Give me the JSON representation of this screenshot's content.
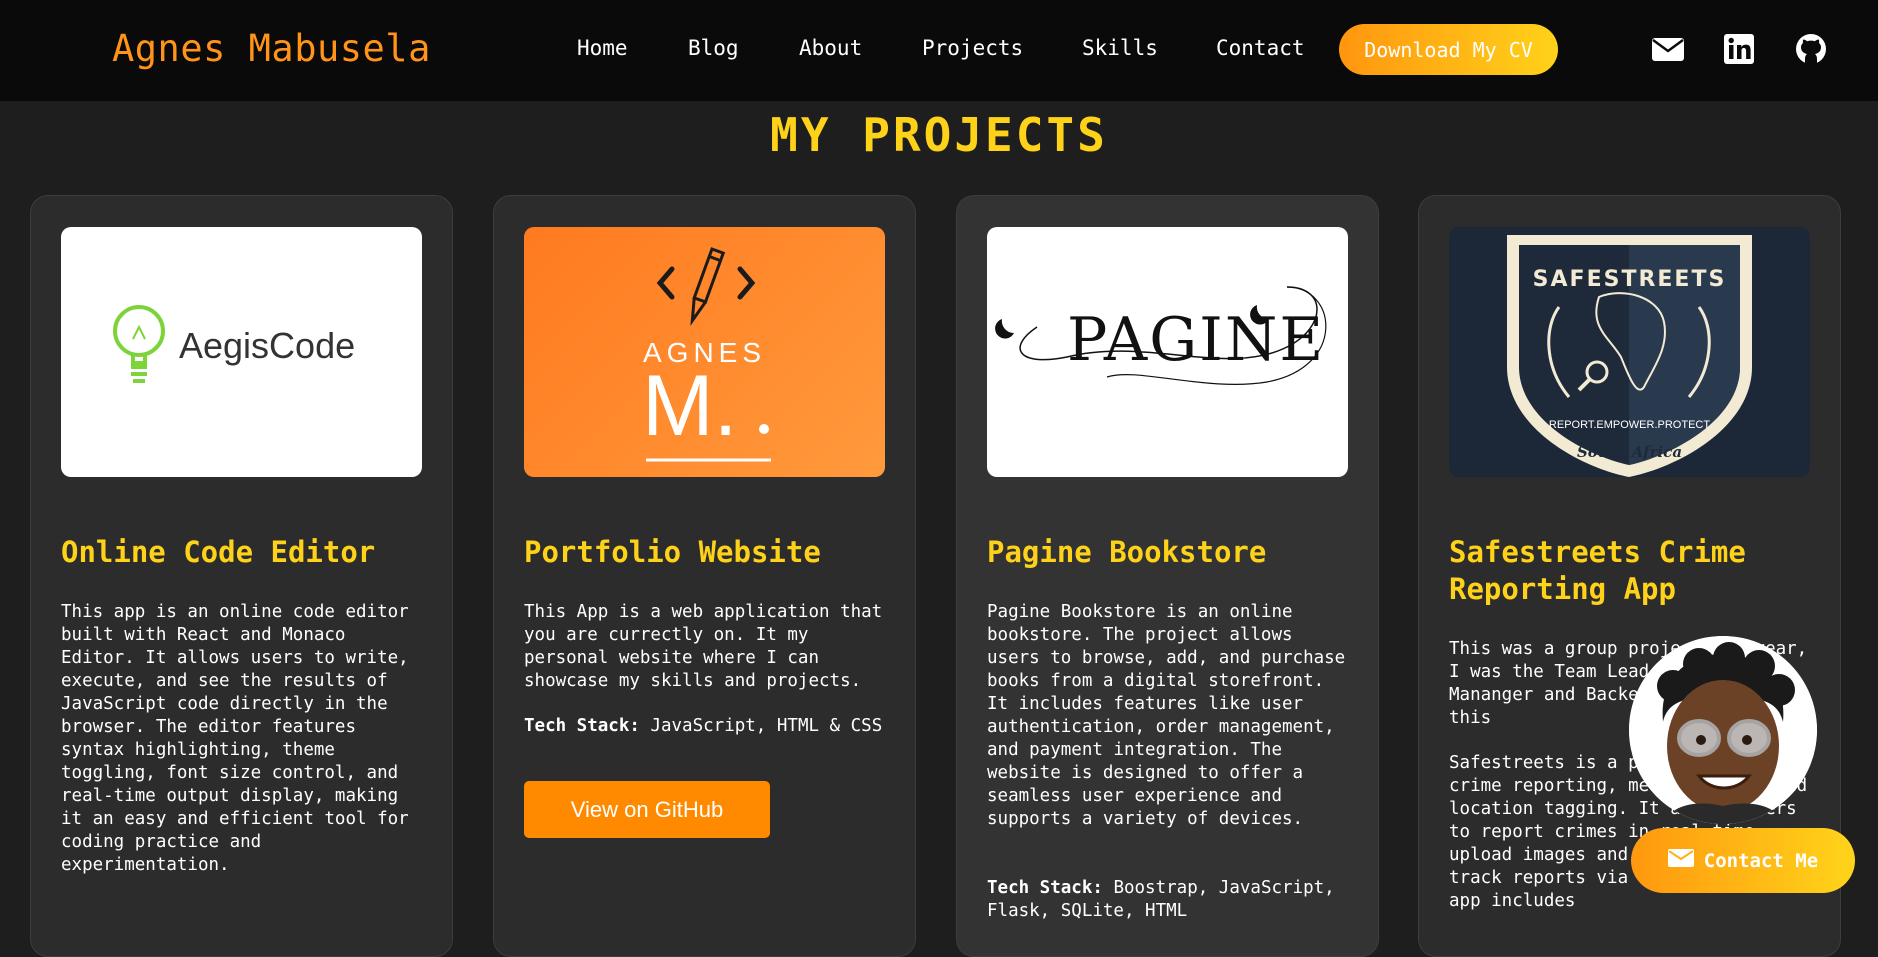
{
  "header": {
    "brand": "Agnes Mabusela",
    "nav": [
      "Home",
      "Blog",
      "About",
      "Projects",
      "Skills",
      "Contact"
    ],
    "cv_button": "Download My CV",
    "social_icons": [
      "envelope-icon",
      "linkedin-icon",
      "github-icon"
    ]
  },
  "main": {
    "title": "MY PROJECTS",
    "projects": [
      {
        "logo_text": "AegisCode",
        "title": "Online Code Editor",
        "description": "This app is an online code editor built with React and Monaco Editor. It allows users to write, execute, and see the results of JavaScript code directly in the browser. The editor features syntax highlighting, theme toggling, font size control, and real-time output display, making it an easy and efficient tool for coding practice and experimentation."
      },
      {
        "logo_text_top": "AGNES",
        "logo_text_big": "M.",
        "title": "Portfolio Website",
        "description": "This App is a web application that you are currectly on. It my personal website where I can showcase my skills and projects.",
        "tech_label": "Tech Stack:",
        "tech_value": " JavaScript, HTML & CSS",
        "button": "View on GitHub"
      },
      {
        "logo_text": "PAGINE",
        "title": "Pagine Bookstore",
        "description": "Pagine Bookstore is an online bookstore. The project allows users to browse, add, and purchase books from a digital storefront. It includes features like user authentication, order management, and payment integration. The website is designed to offer a seamless user experience and supports a variety of devices.",
        "tech_label": "Tech Stack:",
        "tech_value": " Boostrap, JavaScript, Flask, SQLite, HTML"
      },
      {
        "logo_text": "SAFESTREETS",
        "logo_motto": "REPORT.EMPOWER.PROTECT",
        "logo_region": "South Africa",
        "title": "Safestreets Crime Reporting App",
        "description_1": "This was a group project and year, I was the Team Lead, Project Mananger and Backend Developer for this",
        "description_2": "Safestreets is a platform for crime reporting, media upload, and location tagging. It allows users to report crimes in real-time, upload images and videos, and track reports via a dashboard. The app includes"
      }
    ]
  },
  "contact_button": "Contact Me",
  "colors": {
    "accent": "#ffd21a",
    "brand": "#ff9418",
    "github_button": "#ff8a00"
  }
}
